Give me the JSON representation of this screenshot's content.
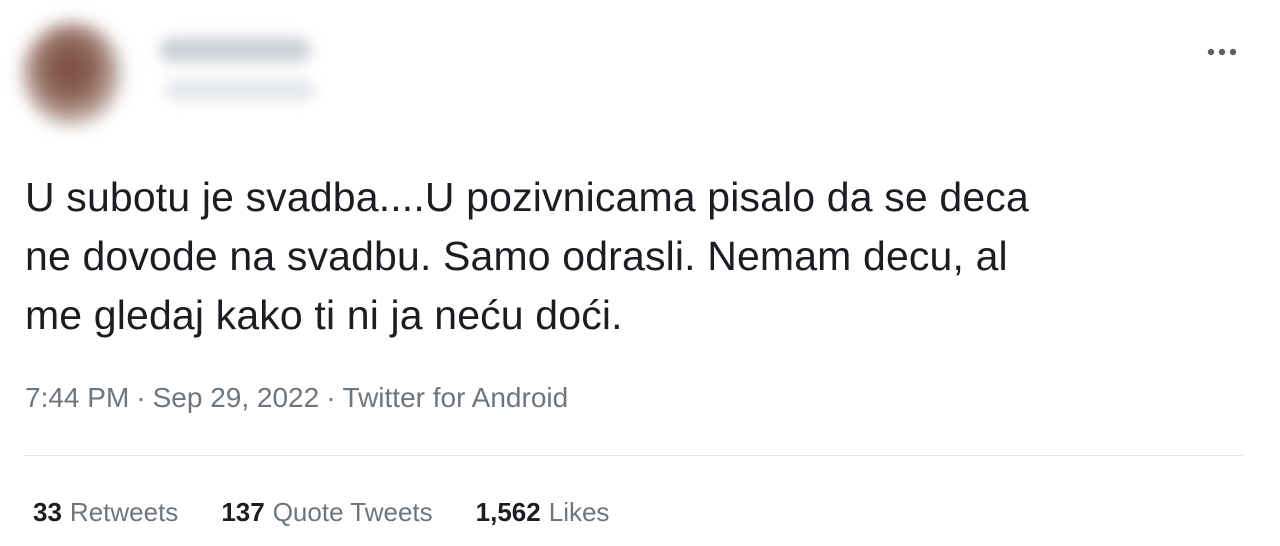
{
  "tweet": {
    "text_lines": [
      "U subotu je svadba....U pozivnicama pisalo da se deca",
      "ne dovode na svadbu. Samo odrasli. Nemam decu, al",
      "me gledaj kako ti ni ja neću doći."
    ],
    "time": "7:44 PM",
    "date": "Sep 29, 2022",
    "separator": "·",
    "source": "Twitter for Android"
  },
  "stats": {
    "retweets": {
      "count": "33",
      "label": "Retweets"
    },
    "quote_tweets": {
      "count": "137",
      "label": "Quote Tweets"
    },
    "likes": {
      "count": "1,562",
      "label": "Likes"
    }
  },
  "icons": {
    "more": "more-horizontal-icon"
  },
  "colors": {
    "text": "#1a1d21",
    "secondary_text": "#6e767d",
    "divider": "#e3e6e9",
    "background": "#ffffff"
  }
}
